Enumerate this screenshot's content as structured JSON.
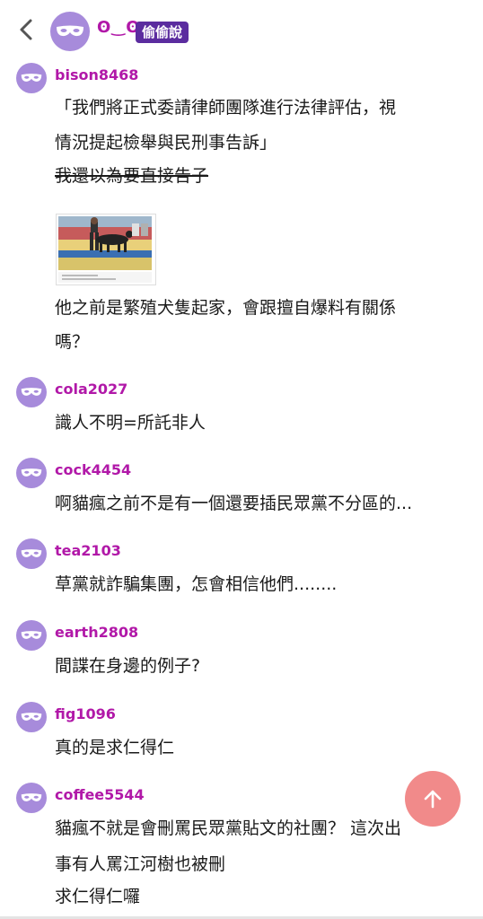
{
  "header": {
    "name": "ʘ‿ʘ",
    "tag": "偷偷說"
  },
  "colors": {
    "avatar": "#a78bdb",
    "username": "#b118a8",
    "tag_bg": "#5b2c9f",
    "fab": "#f08080"
  },
  "icons": {
    "back": "chevron-left-icon",
    "avatar": "mask-icon",
    "fab": "arrow-up-icon"
  },
  "comments": [
    {
      "user": "bison8468",
      "lines": [
        "「我們將正式委請律師團隊進行法律評估，視",
        "情況提起檢舉與民刑事告訴」",
        "我還以為要直接告子"
      ],
      "strike_line": "我還以為要直接告子",
      "after_image_lines": [
        "他之前是繁殖犬隻起家，會跟擅自爆料有關係",
        "嗎？"
      ]
    },
    {
      "user": "cola2027",
      "lines": [
        "識人不明=所託非人"
      ]
    },
    {
      "user": "cock4454",
      "lines": [
        "啊貓瘋之前不是有一個還要插民眾黨不分區的..."
      ]
    },
    {
      "user": "tea2103",
      "lines": [
        "草黨就詐騙集團，怎會相信他們........"
      ]
    },
    {
      "user": "earth2808",
      "lines": [
        "間諜在身邊的例子?"
      ]
    },
    {
      "user": "fig1096",
      "lines": [
        "真的是求仁得仁"
      ]
    },
    {
      "user": "coffee5544",
      "lines": [
        "貓瘋不就是會刪罵民眾黨貼文的社團？ 這次出",
        "事有人罵江河樹也被刪",
        "求仁得仁囉"
      ]
    }
  ]
}
